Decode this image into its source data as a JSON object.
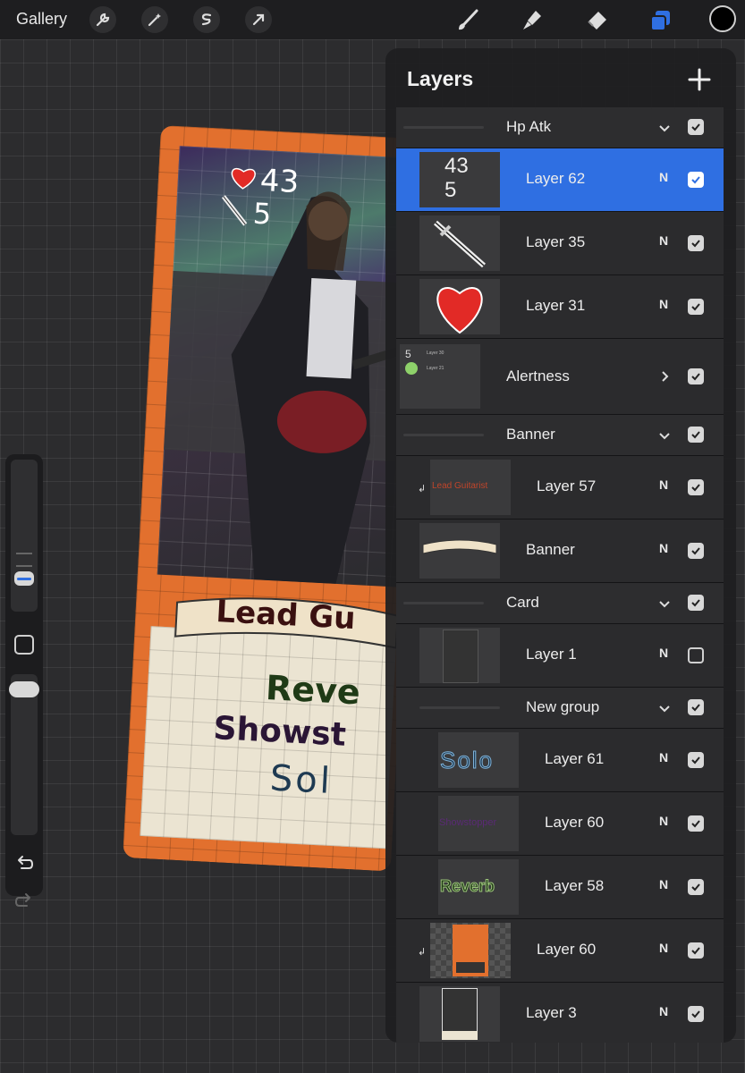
{
  "toolbar": {
    "gallery_label": "Gallery",
    "left_icons": [
      "wrench-icon",
      "magic-wand-icon",
      "selection-s-icon",
      "transform-arrow-icon"
    ],
    "right_tools": [
      "brush-icon",
      "smudge-icon",
      "eraser-icon",
      "layers-icon"
    ],
    "active_tool": "layers-icon",
    "color": "#000000"
  },
  "sidebar": {
    "icons": [
      "brush-size-slider",
      "modify-square-button",
      "opacity-slider",
      "undo-icon",
      "redo-icon"
    ]
  },
  "card": {
    "hp_value": "43",
    "attack_value": "5",
    "banner_text": "Lead Gu",
    "line1": "Reve",
    "line2": "Showst",
    "line3": "Sol",
    "colors": {
      "frame": "#e2702e",
      "textbox": "#ebe4d2",
      "line1": "#1f3a16",
      "line2": "#2a1535",
      "line3": "#1e3a52"
    }
  },
  "layers_panel": {
    "title": "Layers",
    "accent": "#2f6fe2",
    "rows": [
      {
        "kind": "group",
        "name": "Hp Atk",
        "expanded": true,
        "visible": true
      },
      {
        "kind": "layer",
        "name": "Layer 62",
        "mode": "N",
        "visible": true,
        "selected": true,
        "thumb": "43 5"
      },
      {
        "kind": "layer",
        "name": "Layer 35",
        "mode": "N",
        "visible": true,
        "thumb": "sword"
      },
      {
        "kind": "layer",
        "name": "Layer 31",
        "mode": "N",
        "visible": true,
        "thumb": "heart"
      },
      {
        "kind": "group-thumb",
        "name": "Alertness",
        "expanded": false,
        "visible": true,
        "thumb_labels": [
          "Layer 30",
          "Layer 21"
        ]
      },
      {
        "kind": "group",
        "name": "Banner",
        "expanded": true,
        "visible": true
      },
      {
        "kind": "layer",
        "name": "Layer 57",
        "mode": "N",
        "visible": true,
        "clipped": true,
        "thumb": "Lead Guitarist"
      },
      {
        "kind": "layer",
        "name": "Banner",
        "mode": "N",
        "visible": true,
        "thumb": "scroll"
      },
      {
        "kind": "group",
        "name": "Card",
        "expanded": true,
        "visible": true
      },
      {
        "kind": "layer",
        "name": "Layer 1",
        "mode": "N",
        "visible": false,
        "thumb": "card"
      },
      {
        "kind": "group",
        "name": "New group",
        "expanded": true,
        "visible": true,
        "nested": true
      },
      {
        "kind": "layer",
        "name": "Layer 61",
        "mode": "N",
        "visible": true,
        "nested": true,
        "thumb": "Solo"
      },
      {
        "kind": "layer",
        "name": "Layer 60",
        "mode": "N",
        "visible": true,
        "nested": true,
        "thumb": "Showstopper"
      },
      {
        "kind": "layer",
        "name": "Layer 58",
        "mode": "N",
        "visible": true,
        "nested": true,
        "thumb": "Reverb"
      },
      {
        "kind": "layer",
        "name": "Layer 60",
        "mode": "N",
        "visible": true,
        "clipped": true,
        "thumb": "orange-card"
      },
      {
        "kind": "layer",
        "name": "Layer 3",
        "mode": "N",
        "visible": true,
        "thumb": "dark-card"
      }
    ]
  }
}
